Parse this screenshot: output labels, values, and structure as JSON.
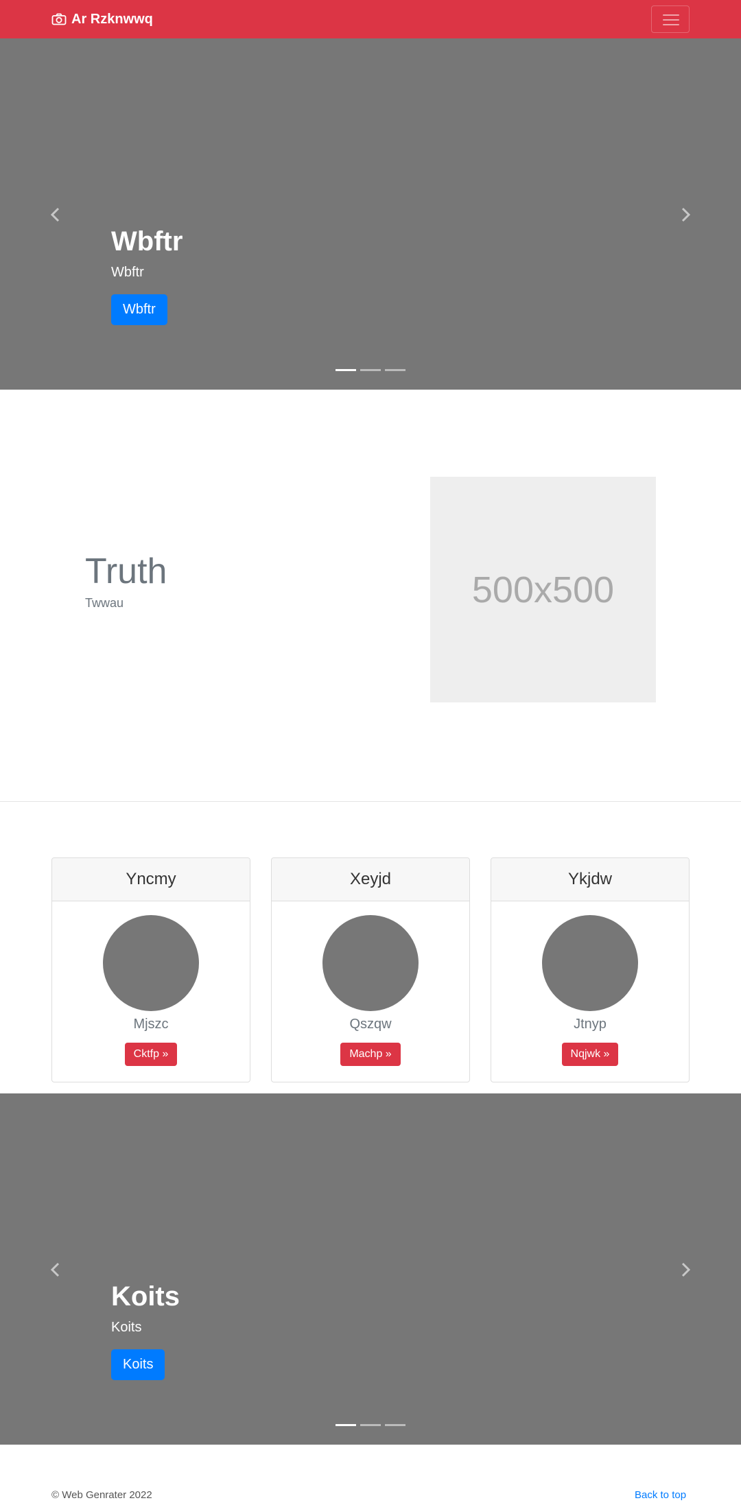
{
  "navbar": {
    "brand": "Ar Rzknwwq",
    "brand_icon": "camera-icon",
    "toggler_icon": "hamburger-icon",
    "color": "#dc3545"
  },
  "hero_carousel": {
    "title": "Wbftr",
    "subtitle": "Wbftr",
    "button_label": "Wbftr",
    "active_slide": 1,
    "slide_count": 3
  },
  "feature": {
    "heading": "Truth",
    "lead": "Twwau",
    "image_placeholder": "500x500"
  },
  "cards": [
    {
      "title": "Yncmy",
      "text": "Mjszc",
      "button_label": "Cktfp »"
    },
    {
      "title": "Xeyjd",
      "text": "Qszqw",
      "button_label": "Machp »"
    },
    {
      "title": "Ykjdw",
      "text": "Jtnyp",
      "button_label": "Nqjwk »"
    }
  ],
  "bottom_carousel": {
    "title": "Koits",
    "subtitle": "Koits",
    "button_label": "Koits",
    "active_slide": 1,
    "slide_count": 3
  },
  "footer": {
    "copyright": "© Web Genrater 2022",
    "back_to_top": "Back to top"
  },
  "colors": {
    "primary": "#007bff",
    "danger": "#dc3545",
    "slide_bg": "#777777"
  }
}
